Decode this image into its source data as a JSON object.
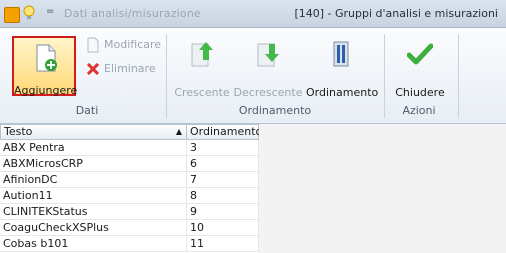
{
  "titlebar": {
    "qa_label": "=",
    "blurred_text": "Dati analisi/misurazione",
    "title": "[140] - Gruppi d'analisi e misurazioni"
  },
  "ribbon": {
    "groups": {
      "dati": "Dati",
      "ordinamento": "Ordinamento",
      "azioni": "Azioni"
    },
    "buttons": {
      "add": "Aggiungere",
      "edit": "Modificare",
      "delete": "Eliminare",
      "ascending": "Crescente",
      "descending": "Decrescente",
      "sort": "Ordinamento",
      "close": "Chiudere"
    }
  },
  "table": {
    "headers": [
      "Testo",
      "Ordinamento"
    ],
    "sort_indicator": "▲",
    "rows": [
      {
        "testo": "ABX Pentra",
        "ordinamento": "3"
      },
      {
        "testo": "ABXMicrosCRP",
        "ordinamento": "6"
      },
      {
        "testo": "AfinionDC",
        "ordinamento": "7"
      },
      {
        "testo": "Aution11",
        "ordinamento": "8"
      },
      {
        "testo": "CLINITEKStatus",
        "ordinamento": "9"
      },
      {
        "testo": "CoaguCheckXSPlus",
        "ordinamento": "10"
      },
      {
        "testo": "Cobas b101",
        "ordinamento": "11"
      }
    ]
  }
}
